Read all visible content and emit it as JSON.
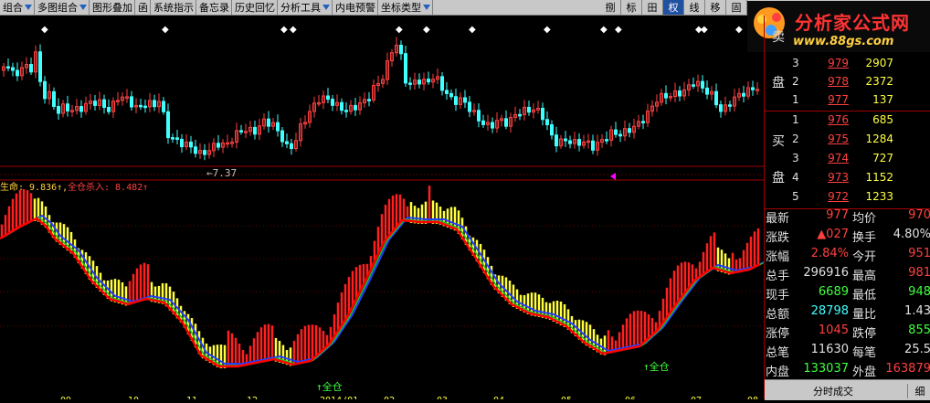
{
  "toolbar": {
    "items": [
      {
        "label": "组合",
        "has_arrow": true
      },
      {
        "label": "多图组合",
        "has_arrow": true
      },
      {
        "label": "图形叠加",
        "has_arrow": false
      },
      {
        "label": "函",
        "has_arrow": false
      },
      {
        "label": "系统指示",
        "has_arrow": false
      },
      {
        "label": "备忘录",
        "has_arrow": false
      },
      {
        "label": "历史回忆",
        "has_arrow": false
      },
      {
        "label": "分析工具",
        "has_arrow": true
      },
      {
        "label": "内电预警",
        "has_arrow": false
      },
      {
        "label": "坐标类型",
        "has_arrow": true
      }
    ],
    "buttons": [
      "捌",
      "标",
      "田",
      "权",
      "线",
      "移",
      "固"
    ],
    "active_button": "权"
  },
  "watermark": {
    "brand": "分析家公式网",
    "url": "www.88gs.com"
  },
  "price_chart": {
    "low_marker": "←7.37",
    "pointer_color": "#ff00ff"
  },
  "indicator": {
    "header_label": "生命: 9.836↑,",
    "header_value": "全仓杀入: 8.482↑",
    "signal_1": "↑全仓",
    "signal_2": "↑全仓"
  },
  "bottom_axis": {
    "dates": [
      "09",
      "10",
      "11",
      "12",
      "2014/01",
      "02",
      "03",
      "04",
      "05",
      "06",
      "07",
      "08",
      "09"
    ]
  },
  "orderbook": {
    "sell_label_fragment": "卖",
    "sell_label_2": "盘",
    "sell": [
      {
        "level": "3",
        "price": "979",
        "volume": "2907"
      },
      {
        "level": "2",
        "price": "978",
        "volume": "2372"
      },
      {
        "level": "1",
        "price": "977",
        "volume": "137"
      }
    ],
    "buy_label_1": "买",
    "buy_label_2": "盘",
    "buy": [
      {
        "level": "1",
        "price": "976",
        "volume": "685"
      },
      {
        "level": "2",
        "price": "975",
        "volume": "1284"
      },
      {
        "level": "3",
        "price": "974",
        "volume": "727"
      },
      {
        "level": "4",
        "price": "973",
        "volume": "1152"
      },
      {
        "level": "5",
        "price": "972",
        "volume": "1233"
      }
    ]
  },
  "quote": [
    {
      "l1": "最新",
      "v1": "977",
      "c1": "red",
      "l2": "均价",
      "v2": "970",
      "c2": "red"
    },
    {
      "l1": "涨跌",
      "v1": "▲027",
      "c1": "red",
      "l2": "换手",
      "v2": "4.80%",
      "c2": "white"
    },
    {
      "l1": "涨幅",
      "v1": "2.84%",
      "c1": "red",
      "l2": "今开",
      "v2": "951",
      "c2": "red"
    },
    {
      "l1": "总手",
      "v1": "296916",
      "c1": "white",
      "l2": "最高",
      "v2": "981",
      "c2": "red"
    },
    {
      "l1": "现手",
      "v1": "6689",
      "c1": "green",
      "l2": "最低",
      "v2": "948",
      "c2": "green"
    },
    {
      "l1": "总额",
      "v1": "28798",
      "c1": "cyan",
      "l2": "量比",
      "v2": "1.43",
      "c2": "white"
    },
    {
      "l1": "涨停",
      "v1": "1045",
      "c1": "red",
      "l2": "跌停",
      "v2": "855",
      "c2": "green"
    },
    {
      "l1": "总笔",
      "v1": "11630",
      "c1": "white",
      "l2": "每笔",
      "v2": "25.5",
      "c2": "white"
    },
    {
      "l1": "内盘",
      "v1": "133037",
      "c1": "green",
      "l2": "外盘",
      "v2": "163879",
      "c2": "red"
    }
  ],
  "tabs": {
    "fbcj": "分时成交",
    "xi": "细"
  },
  "colors": {
    "up": "#ff4040",
    "down": "#40ffff",
    "ind_red": "#ff2020",
    "ind_yellow": "#ffff40",
    "blue": "#2040ff",
    "green": "#20c020",
    "grid": "#800000"
  }
}
